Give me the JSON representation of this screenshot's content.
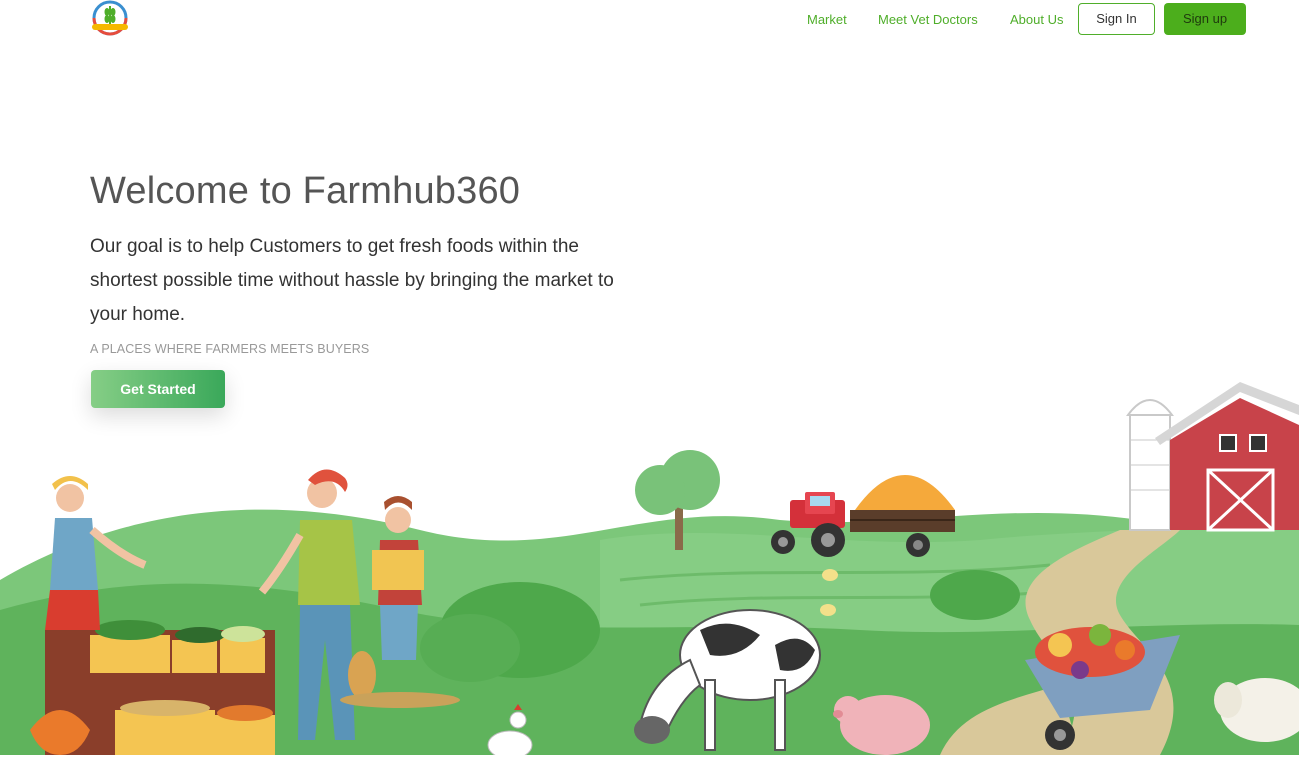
{
  "nav": {
    "logo_icon": "farmhub-logo-icon",
    "links": [
      {
        "label": "Market"
      },
      {
        "label": "Meet Vet Doctors"
      },
      {
        "label": "About Us"
      }
    ],
    "sign_in_label": "Sign In",
    "sign_up_label": "Sign up"
  },
  "hero": {
    "title": "Welcome to Farmhub360",
    "description": "Our goal is to help Customers to get fresh foods within the shortest possible time without hassle by bringing the market to your home.",
    "tagline": "A PLACES WHERE FARMERS MEETS BUYERS",
    "cta_label": "Get Started"
  },
  "illustration": {
    "icon": "farm-market-illustration",
    "elements": [
      "vendor-woman",
      "shopping-woman",
      "girl-with-bag",
      "produce-stall",
      "tree",
      "tractor",
      "hay-cart",
      "barn",
      "silo",
      "cow",
      "pig",
      "chicken",
      "sheep",
      "wheelbarrow-vegetables",
      "path"
    ]
  },
  "colors": {
    "brand_green": "#4fae2a",
    "signup_bg": "#4cae1c",
    "cta_gradient_start": "#86ce86",
    "cta_gradient_end": "#3aa85a",
    "grass": "#6dbf6a",
    "barn_red": "#c8434a"
  }
}
